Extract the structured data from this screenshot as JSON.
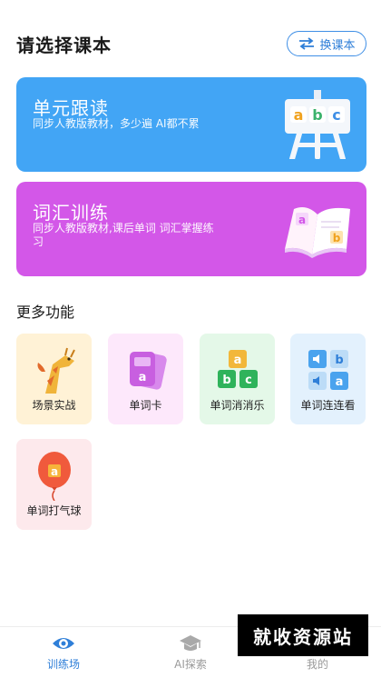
{
  "header": {
    "title": "请选择课本",
    "switch_label": "换课本"
  },
  "cards": [
    {
      "title": "单元跟读",
      "desc": "同步人教版教材，多少遍 AI都不累",
      "color": "#42a5f5"
    },
    {
      "title": "词汇训练",
      "desc": "同步人教版教材,课后单词 词汇掌握练习",
      "color": "#d357e8"
    }
  ],
  "card_art": {
    "abc": [
      "a",
      "b",
      "c"
    ],
    "book_letters": [
      "a",
      "b"
    ]
  },
  "section": {
    "title": "更多功能"
  },
  "features": [
    {
      "label": "场景实战",
      "bg": "#fff2d6",
      "icon": "giraffe-icon"
    },
    {
      "label": "单词卡",
      "bg": "#fde8fb",
      "icon": "word-cards-icon"
    },
    {
      "label": "单词消消乐",
      "bg": "#e4f8e8",
      "icon": "letter-blocks-icon"
    },
    {
      "label": "单词连连看",
      "bg": "#e3f1fd",
      "icon": "match-tiles-icon"
    },
    {
      "label": "单词打气球",
      "bg": "#fde9ec",
      "icon": "balloon-icon"
    }
  ],
  "feature_letters": {
    "card": "a",
    "blocks": [
      "a",
      "b",
      "c"
    ],
    "tiles": [
      "b",
      "a"
    ],
    "balloon": "a"
  },
  "nav": [
    {
      "label": "训练场",
      "active": true
    },
    {
      "label": "AI探索",
      "active": false
    },
    {
      "label": "我的",
      "active": false
    }
  ],
  "colors": {
    "accent": "#2f7fd8",
    "nav_active": "#2f7fd8",
    "nav_inactive": "#9a9a9a"
  },
  "watermark": "就收资源站"
}
